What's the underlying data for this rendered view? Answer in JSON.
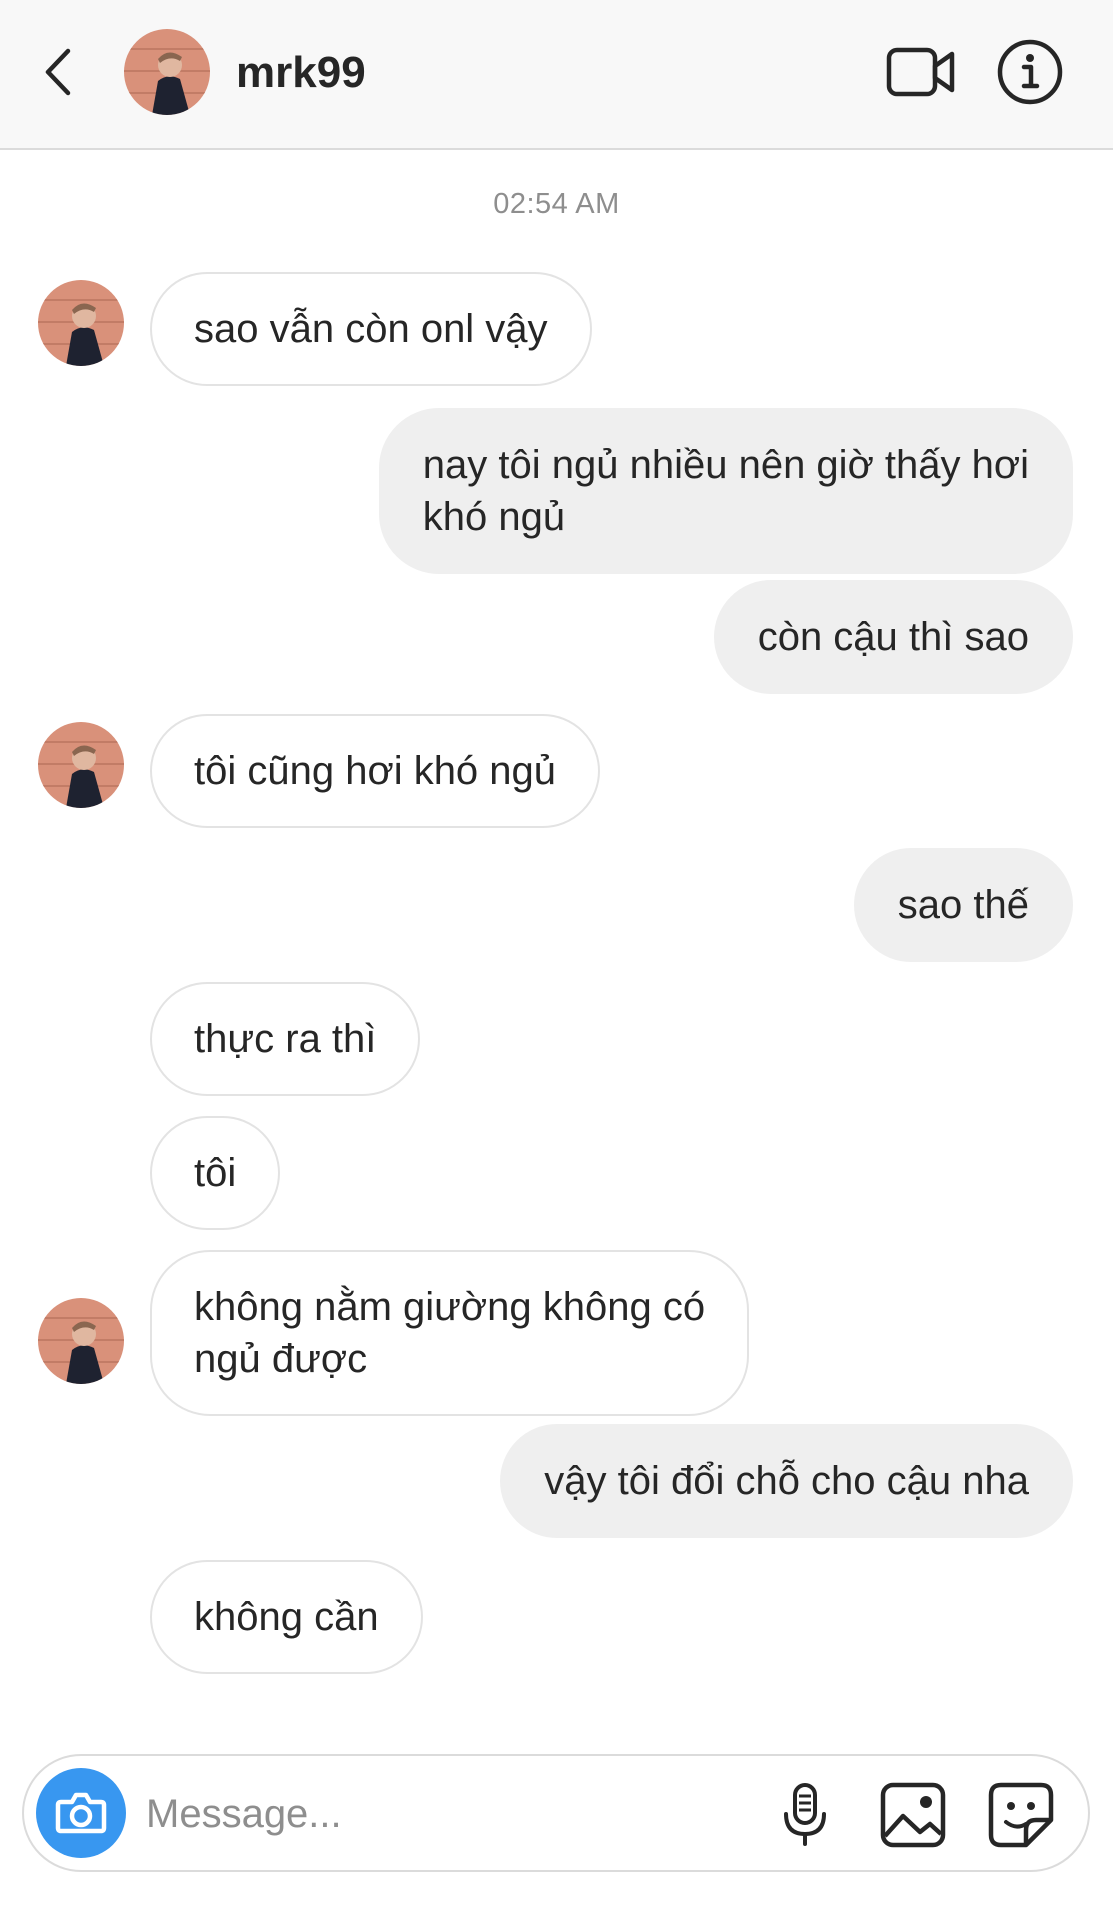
{
  "header": {
    "username": "mrk99"
  },
  "chat": {
    "timestamp": "02:54 AM",
    "messages": [
      {
        "from": "them",
        "lines": [
          "sao vẫn còn onl vậy"
        ]
      },
      {
        "from": "me",
        "lines": [
          "nay tôi ngủ nhiều nên giờ thấy hơi",
          "khó ngủ"
        ]
      },
      {
        "from": "me",
        "lines": [
          "còn cậu thì sao"
        ]
      },
      {
        "from": "them",
        "lines": [
          "tôi cũng hơi khó ngủ"
        ]
      },
      {
        "from": "me",
        "lines": [
          "sao thế"
        ]
      },
      {
        "from": "them",
        "lines": [
          "thực ra thì"
        ]
      },
      {
        "from": "them",
        "lines": [
          "tôi"
        ]
      },
      {
        "from": "them",
        "lines": [
          "không nằm giường không có",
          "ngủ được"
        ]
      },
      {
        "from": "me",
        "lines": [
          "vậy tôi đổi chỗ cho cậu nha"
        ]
      },
      {
        "from": "them",
        "lines": [
          "không cần"
        ]
      }
    ]
  },
  "composer": {
    "placeholder": "Message..."
  },
  "colors": {
    "accent": "#3897f0",
    "header_bg": "#f8f8f8",
    "outgoing_bubble": "#efefef",
    "incoming_border": "#e3e3e3",
    "text": "#262626",
    "muted": "#8e8e8e"
  },
  "icons": [
    "chevron-left-icon",
    "video-camera-icon",
    "info-icon",
    "camera-icon",
    "microphone-icon",
    "gallery-icon",
    "sticker-icon"
  ]
}
